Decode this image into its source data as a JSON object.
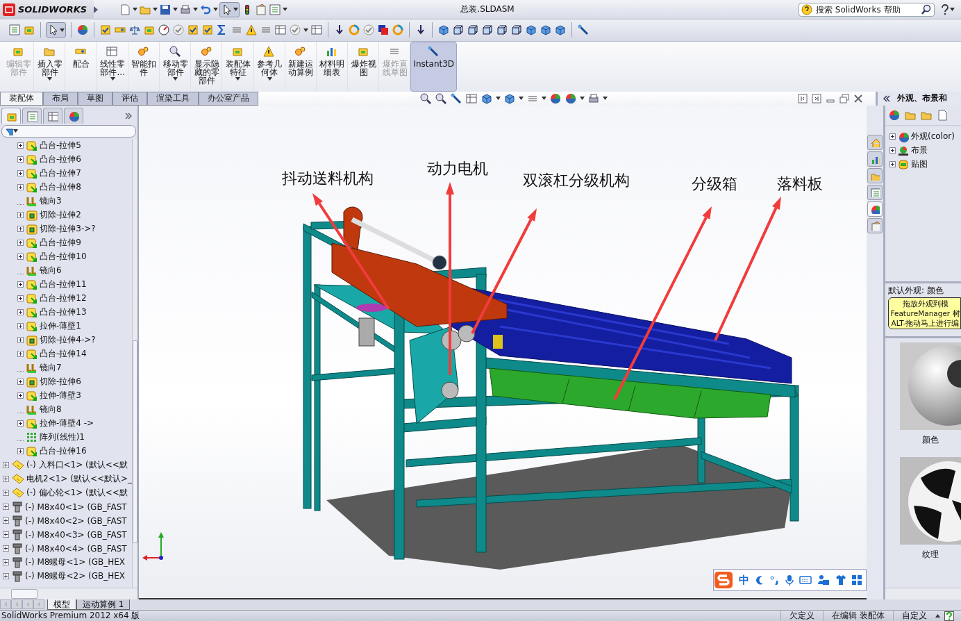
{
  "app": {
    "logo": "SOLIDWORKS",
    "title": "总装.SLDASM"
  },
  "search": {
    "placeholder": "搜索 SolidWorks 帮助"
  },
  "command_buttons": [
    {
      "label": "编辑零部件",
      "disabled": true,
      "dropdown": false,
      "selected": false
    },
    {
      "label": "插入零部件",
      "disabled": false,
      "dropdown": true,
      "selected": false
    },
    {
      "label": "配合",
      "disabled": false,
      "dropdown": false,
      "selected": false
    },
    {
      "label": "线性零部件...",
      "disabled": false,
      "dropdown": true,
      "selected": false
    },
    {
      "label": "智能扣件",
      "disabled": false,
      "dropdown": false,
      "selected": false
    },
    {
      "label": "移动零部件",
      "disabled": false,
      "dropdown": true,
      "selected": false
    },
    {
      "label": "显示隐藏的零部件",
      "disabled": false,
      "dropdown": false,
      "selected": false
    },
    {
      "label": "装配体特征",
      "disabled": false,
      "dropdown": true,
      "selected": false
    },
    {
      "label": "参考几何体",
      "disabled": false,
      "dropdown": true,
      "selected": false
    },
    {
      "label": "新建运动算例",
      "disabled": false,
      "dropdown": false,
      "selected": false
    },
    {
      "label": "材料明细表",
      "disabled": false,
      "dropdown": false,
      "selected": false
    },
    {
      "label": "爆炸视图",
      "disabled": false,
      "dropdown": false,
      "selected": false
    },
    {
      "label": "爆炸直线草图",
      "disabled": true,
      "dropdown": false,
      "selected": false
    },
    {
      "label": "Instant3D",
      "disabled": false,
      "dropdown": false,
      "selected": true
    }
  ],
  "command_tabs": [
    {
      "label": "装配体",
      "selected": true
    },
    {
      "label": "布局",
      "selected": false
    },
    {
      "label": "草图",
      "selected": false
    },
    {
      "label": "评估",
      "selected": false
    },
    {
      "label": "渲染工具",
      "selected": false
    },
    {
      "label": "办公室产品",
      "selected": false
    }
  ],
  "panel_tabs": [
    {
      "selected": true
    },
    {
      "selected": false
    },
    {
      "selected": false
    },
    {
      "selected": false
    }
  ],
  "feature_tree": {
    "nested_features": [
      {
        "label": "凸台-拉伸5",
        "kind": "boss",
        "expandable": true
      },
      {
        "label": "凸台-拉伸6",
        "kind": "boss",
        "expandable": true
      },
      {
        "label": "凸台-拉伸7",
        "kind": "boss",
        "expandable": true
      },
      {
        "label": "凸台-拉伸8",
        "kind": "boss",
        "expandable": true
      },
      {
        "label": "镜向3",
        "kind": "mirror",
        "expandable": false
      },
      {
        "label": "切除-拉伸2",
        "kind": "cut",
        "expandable": true
      },
      {
        "label": "切除-拉伸3->?",
        "kind": "cut",
        "expandable": true
      },
      {
        "label": "凸台-拉伸9",
        "kind": "boss",
        "expandable": true
      },
      {
        "label": "凸台-拉伸10",
        "kind": "boss",
        "expandable": true
      },
      {
        "label": "镜向6",
        "kind": "mirror",
        "expandable": false
      },
      {
        "label": "凸台-拉伸11",
        "kind": "boss",
        "expandable": true
      },
      {
        "label": "凸台-拉伸12",
        "kind": "boss",
        "expandable": true
      },
      {
        "label": "凸台-拉伸13",
        "kind": "boss",
        "expandable": true
      },
      {
        "label": "拉伸-薄壁1",
        "kind": "boss",
        "expandable": true
      },
      {
        "label": "切除-拉伸4->?",
        "kind": "cut",
        "expandable": true
      },
      {
        "label": "凸台-拉伸14",
        "kind": "boss",
        "expandable": true
      },
      {
        "label": "镜向7",
        "kind": "mirror",
        "expandable": false
      },
      {
        "label": "切除-拉伸6",
        "kind": "cut",
        "expandable": true
      },
      {
        "label": "拉伸-薄壁3",
        "kind": "boss",
        "expandable": true
      },
      {
        "label": "镜向8",
        "kind": "mirror",
        "expandable": false
      },
      {
        "label": "拉伸-薄壁4 ->",
        "kind": "boss",
        "expandable": true
      },
      {
        "label": "阵列(线性)1",
        "kind": "pattern",
        "expandable": false
      },
      {
        "label": "凸台-拉伸16",
        "kind": "boss",
        "expandable": true
      }
    ],
    "components": [
      {
        "label": "(-) 入料口<1> (默认<<默",
        "kind": "part",
        "expandable": true
      },
      {
        "label": "电机2<1> (默认<<默认>_",
        "kind": "part",
        "expandable": true
      },
      {
        "label": "(-) 偏心轮<1> (默认<<默",
        "kind": "part",
        "expandable": true
      },
      {
        "label": "(-) M8x40<1> (GB_FAST",
        "kind": "fastener",
        "expandable": true
      },
      {
        "label": "(-) M8x40<2> (GB_FAST",
        "kind": "fastener",
        "expandable": true
      },
      {
        "label": "(-) M8x40<3> (GB_FAST",
        "kind": "fastener",
        "expandable": true
      },
      {
        "label": "(-) M8x40<4> (GB_FAST",
        "kind": "fastener",
        "expandable": true
      },
      {
        "label": "(-) M8螺母<1> (GB_HEX",
        "kind": "fastener",
        "expandable": true
      },
      {
        "label": "(-) M8螺母<2> (GB_HEX",
        "kind": "fastener",
        "expandable": true
      }
    ]
  },
  "callouts": [
    {
      "label": "抖动送料机构"
    },
    {
      "label": "动力电机"
    },
    {
      "label": "双滚杠分级机构"
    },
    {
      "label": "分级箱"
    },
    {
      "label": "落料板"
    }
  ],
  "task_pane_tabs": [
    {
      "selected": false
    },
    {
      "selected": false
    },
    {
      "selected": false
    },
    {
      "selected": false
    },
    {
      "selected": true
    },
    {
      "selected": false
    }
  ],
  "task_pane": {
    "title": "外观、布景和",
    "items": [
      {
        "label": "外观(color)",
        "kind": "appearance"
      },
      {
        "label": "布景",
        "kind": "scene"
      },
      {
        "label": "贴图",
        "kind": "decal"
      }
    ],
    "default_label": "默认外观: 颜色",
    "hint_lines": [
      "拖放外观到模",
      "FeatureManager 树",
      "ALT-拖动马上进行编"
    ],
    "thumbnails": [
      {
        "label": "颜色",
        "kind": "gloss"
      },
      {
        "label": "纹理",
        "kind": "checker"
      }
    ]
  },
  "ime_bar": {
    "mode": "中"
  },
  "bottom_tabs": [
    {
      "label": "模型",
      "selected": true
    },
    {
      "label": "运动算例 1",
      "selected": false
    }
  ],
  "status_bar": {
    "product": "SolidWorks Premium 2012 x64 版",
    "fields": [
      "欠定义",
      "在编辑 装配体",
      "自定义"
    ]
  }
}
